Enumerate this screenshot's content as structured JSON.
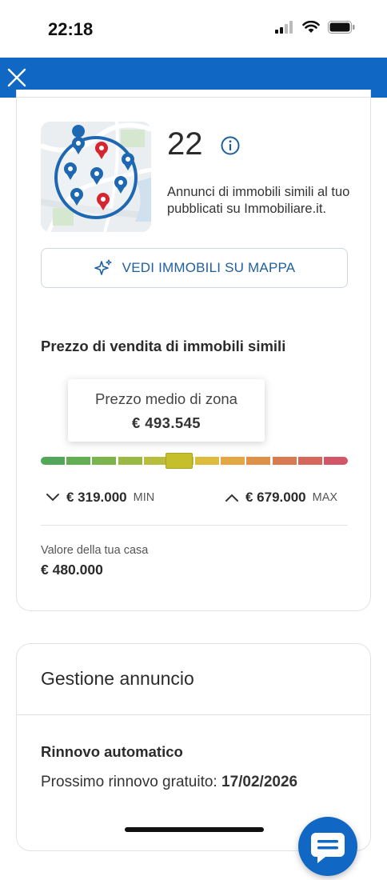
{
  "status_bar": {
    "time": "22:18"
  },
  "similar": {
    "count": "22",
    "description": "Annunci di immobili simili al tuo pubblicati su Immobiliare.it.",
    "map_button_label": "VEDI IMMOBILI SU MAPPA"
  },
  "price": {
    "title": "Prezzo di vendita di immobili simili",
    "tooltip_label": "Prezzo medio di zona",
    "tooltip_value": "€ 493.545",
    "min_value": "€ 319.000",
    "min_unit": "MIN",
    "max_value": "€ 679.000",
    "max_unit": "MAX",
    "marker_position": 0.45
  },
  "your_home": {
    "label": "Valore della tua casa",
    "value": "€ 480.000"
  },
  "listing": {
    "title": "Gestione annuncio",
    "subtitle": "Rinnovo automatico",
    "renew_prefix": "Prossimo rinnovo gratuito: ",
    "renew_date": "17/02/2026"
  },
  "colors": {
    "brand_blue": "#1168c4",
    "link_blue": "#1e5f9e",
    "bar": [
      "#52a85a",
      "#63ad52",
      "#7cb44c",
      "#9ab944",
      "#b9bd3d",
      "#cfc03a",
      "#ddbb3c",
      "#e3a844",
      "#df9049",
      "#da7a50",
      "#d6675a",
      "#d4556a"
    ]
  }
}
